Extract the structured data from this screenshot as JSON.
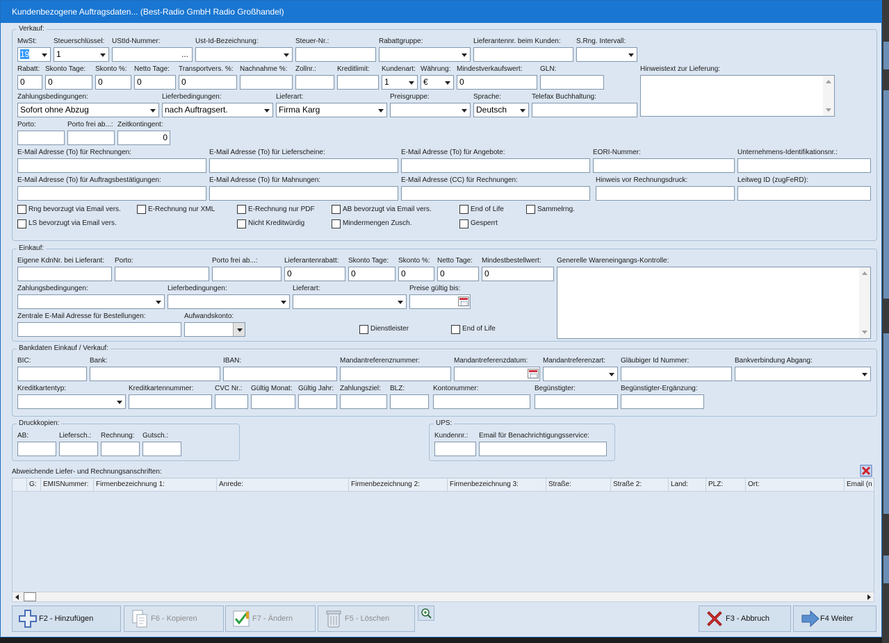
{
  "title": "Kundenbezogene Auftragsdaten... (Best-Radio GmbH Radio Großhandel)",
  "verkauf": {
    "caption": "Verkauf:",
    "labels": {
      "mwst": "MwSt:",
      "steuerschluessel": "Steuerschlüssel:",
      "ustid": "UStId-Nummer:",
      "ustid_bez": "Ust-Id-Bezeichnung:",
      "steuernr": "Steuer-Nr.:",
      "rabattgruppe": "Rabattgruppe:",
      "lieferantennr": "Lieferantennr. beim Kunden:",
      "srng": "S.Rng. Intervall:",
      "rabatt": "Rabatt:",
      "skontotage": "Skonto Tage:",
      "skontoproz": "Skonto %:",
      "nettotage": "Netto Tage:",
      "transportvers": "Transportvers. %:",
      "nachnahme": "Nachnahme %:",
      "zollnr": "Zollnr.:",
      "kreditlimit": "Kreditlimit:",
      "kundenart": "Kundenart:",
      "waehrung": "Währung:",
      "mindestverkaufswert": "Mindestverkaufswert:",
      "gln": "GLN:",
      "hinweistext": "Hinweistext zur Lieferung:",
      "zahlungsbedingungen": "Zahlungsbedingungen:",
      "lieferbedingungen": "Lieferbedingungen:",
      "lieferart": "Lieferart:",
      "preisgruppe": "Preisgruppe:",
      "sprache": "Sprache:",
      "telefax": "Telefax Buchhaltung:",
      "porto": "Porto:",
      "portofrei": "Porto frei ab...:",
      "zeitkontingent": "Zeitkontingent:",
      "email_rechnungen": "E-Mail Adresse (To) für Rechnungen:",
      "email_lieferscheine": "E-Mail Adresse (To) für Lieferscheine:",
      "email_angebote": "E-Mail Adresse (To) für Angebote:",
      "eori": "EORI-Nummer:",
      "unternehmens_id": "Unternehmens-Identifikationsnr.:",
      "email_ab": "E-Mail Adresse (To) für Auftragsbestätigungen:",
      "email_mahnungen": "E-Mail Adresse (To) für Mahnungen:",
      "email_cc": "E-Mail Adresse (CC) für Rechnungen:",
      "hinweis_druck": "Hinweis vor Rechnungsdruck:",
      "leitweg": "Leitweg ID (zugFeRD):"
    },
    "values": {
      "mwst": "19",
      "steuerschluessel": "1",
      "ustid_btn": "...",
      "rabatt": "0",
      "skontotage": "0",
      "skontoproz": "0",
      "nettotage": "0",
      "transportvers": "0",
      "kundenart": "1",
      "waehrung": "€",
      "mindestverkaufswert": "0",
      "zahlungsbedingungen": "Sofort ohne Abzug",
      "lieferbedingungen": "nach  Auftragsert.",
      "lieferart": "Firma Karg",
      "sprache": "Deutsch",
      "zeitkontingent": "0"
    },
    "checkboxes": [
      "Rng bevorzugt via Email vers.",
      "E-Rechnung nur XML",
      "E-Rechnung nur PDF",
      "AB bevorzugt via Email vers.",
      "End of Life",
      "Sammelrng.",
      "LS bevorzugt via Email vers.",
      "Nicht Kreditwürdig",
      "Mindermengen Zusch.",
      "Gesperrt"
    ]
  },
  "einkauf": {
    "caption": "Einkauf:",
    "labels": {
      "eigene_kdnnr": "Eigene KdnNr. bei Lieferant:",
      "porto": "Porto:",
      "portofrei": "Porto frei ab...:",
      "lieferantenrabatt": "Lieferantenrabatt:",
      "skontotage": "Skonto Tage:",
      "skontoproz": "Skonto %:",
      "nettotage": "Netto Tage:",
      "mindestbestellwert": "Mindestbestellwert:",
      "wareneingang": "Generelle Wareneingangs-Kontrolle:",
      "zahlungsbedingungen": "Zahlungsbedingungen:",
      "lieferbedingungen": "Lieferbedingungen:",
      "lieferart": "Lieferart:",
      "preise_gueltig": "Preise gültig bis:",
      "zentrale_email": "Zentrale E-Mail Adresse für Bestellungen:",
      "aufwandskonto": "Aufwandskonto:"
    },
    "values": {
      "lieferantenrabatt": "0",
      "skontotage": "0",
      "skontoproz": "0",
      "nettotage": "0",
      "mindestbestellwert": "0"
    },
    "checkboxes": [
      "Dienstleister",
      "End of Life"
    ]
  },
  "bank": {
    "caption": "Bankdaten Einkauf / Verkauf:",
    "labels": {
      "bic": "BIC:",
      "bank": "Bank:",
      "iban": "IBAN:",
      "mandantreferenznummer": "Mandantreferenznummer:",
      "mandantreferenzdatum": "Mandantreferenzdatum:",
      "mandantreferenzart": "Mandantreferenzart:",
      "glaeubiger": "Gläubiger Id Nummer:",
      "bankverbindung_abgang": "Bankverbindung Abgang:",
      "kreditkartentyp": "Kreditkartentyp:",
      "kreditkartennummer": "Kreditkartennummer:",
      "cvc": "CVC Nr.:",
      "gueltig_monat": "Gültig Monat:",
      "gueltig_jahr": "Gültig Jahr:",
      "zahlungsziel": "Zahlungsziel:",
      "blz": "BLZ:",
      "kontonummer": "Kontonummer:",
      "beguenstigter": "Begünstigter:",
      "beguenstigter_erg": "Begünstigter-Ergänzung:"
    }
  },
  "druckkopien": {
    "caption": "Druckkopien:",
    "labels": {
      "ab": "AB:",
      "liefersch": "Liefersch.:",
      "rechnung": "Rechnung:",
      "gutsch": "Gutsch.:"
    }
  },
  "ups": {
    "caption": "UPS:",
    "labels": {
      "kundennr": "Kundennr.:",
      "email": "Email für Benachrichtigungsservice:"
    }
  },
  "grid": {
    "caption": "Abweichende Liefer- und Rechnungsanschriften:",
    "columns": [
      "G:",
      "EMISNummer:",
      "Firmenbezeichnung 1:",
      "Anrede:",
      "Firmenbezeichnung 2:",
      "Firmenbezeichnung 3:",
      "Straße:",
      "Straße 2:",
      "Land:",
      "PLZ:",
      "Ort:",
      "Email (n"
    ]
  },
  "buttons": {
    "add": "F2 - Hinzufügen",
    "copy": "F6 - Kopieren",
    "edit": "F7 - Ändern",
    "delete": "F5 - Löschen",
    "cancel": "F3 - Abbruch",
    "next": "F4 Weiter"
  },
  "colors": {
    "titlebar": "#1976d2",
    "window": "#dce6f2",
    "border": "#a9bfd6"
  }
}
